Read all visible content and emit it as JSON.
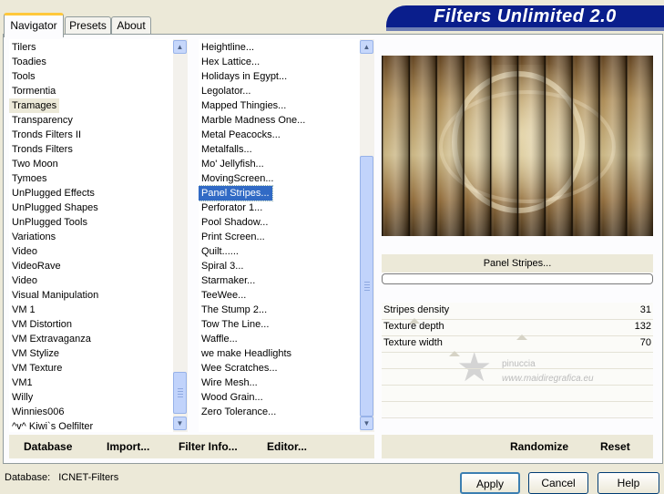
{
  "app": {
    "title": "Filters Unlimited 2.0",
    "tabs": [
      {
        "label": "Navigator"
      },
      {
        "label": "Presets"
      },
      {
        "label": "About"
      }
    ]
  },
  "categories": {
    "items": [
      "Tilers",
      "Toadies",
      "Tools",
      "Tormentia",
      "Tramages",
      "Transparency",
      "Tronds Filters II",
      "Tronds Filters",
      "Two Moon",
      "Tymoes",
      "UnPlugged Effects",
      "UnPlugged Shapes",
      "UnPlugged Tools",
      "Variations",
      "Video",
      "VideoRave",
      "Video",
      "Visual Manipulation",
      "VM 1",
      "VM Distortion",
      "VM Extravaganza",
      "VM Stylize",
      "VM Texture",
      "VM1",
      "Willy",
      "Winnies006",
      "^v^ Kiwi`s Oelfilter"
    ],
    "highlighted": "Tramages"
  },
  "filters": {
    "items": [
      "Heightline...",
      "Hex Lattice...",
      "Holidays in Egypt...",
      "Legolator...",
      "Mapped Thingies...",
      "Marble Madness One...",
      "Metal Peacocks...",
      "Metalfalls...",
      "Mo' Jellyfish...",
      "MovingScreen...",
      "Panel Stripes...",
      "Perforator 1...",
      "Pool Shadow...",
      "Print Screen...",
      "Quilt......",
      "Spiral 3...",
      "Starmaker...",
      "TeeWee...",
      "The Stump 2...",
      "Tow The Line...",
      "Waffle...",
      "we make Headlights",
      "Wee Scratches...",
      "Wire Mesh...",
      "Wood Grain...",
      "Zero Tolerance..."
    ],
    "selected": "Panel Stripes..."
  },
  "left_buttons": {
    "database": "Database",
    "import": "Import...",
    "filter_info": "Filter Info...",
    "editor": "Editor..."
  },
  "right_buttons": {
    "randomize": "Randomize",
    "reset": "Reset"
  },
  "preview": {
    "filter_name": "Panel Stripes...",
    "progress": 0
  },
  "params": [
    {
      "label": "Stripes density",
      "value": "31",
      "fraction": 0.12
    },
    {
      "label": "Texture depth",
      "value": "132",
      "fraction": 0.52
    },
    {
      "label": "Texture width",
      "value": "70",
      "fraction": 0.27
    }
  ],
  "watermark": {
    "line1": "pinuccia",
    "line2": "www.maidiregrafica.eu"
  },
  "status": {
    "database_label": "Database:",
    "database_value": "ICNET-Filters"
  },
  "dialog_buttons": {
    "apply": "Apply",
    "cancel": "Cancel",
    "help": "Help"
  },
  "colors": {
    "banner": "#0a1e8c",
    "selection": "#316ac5",
    "tab_accent": "#ffc83c"
  }
}
